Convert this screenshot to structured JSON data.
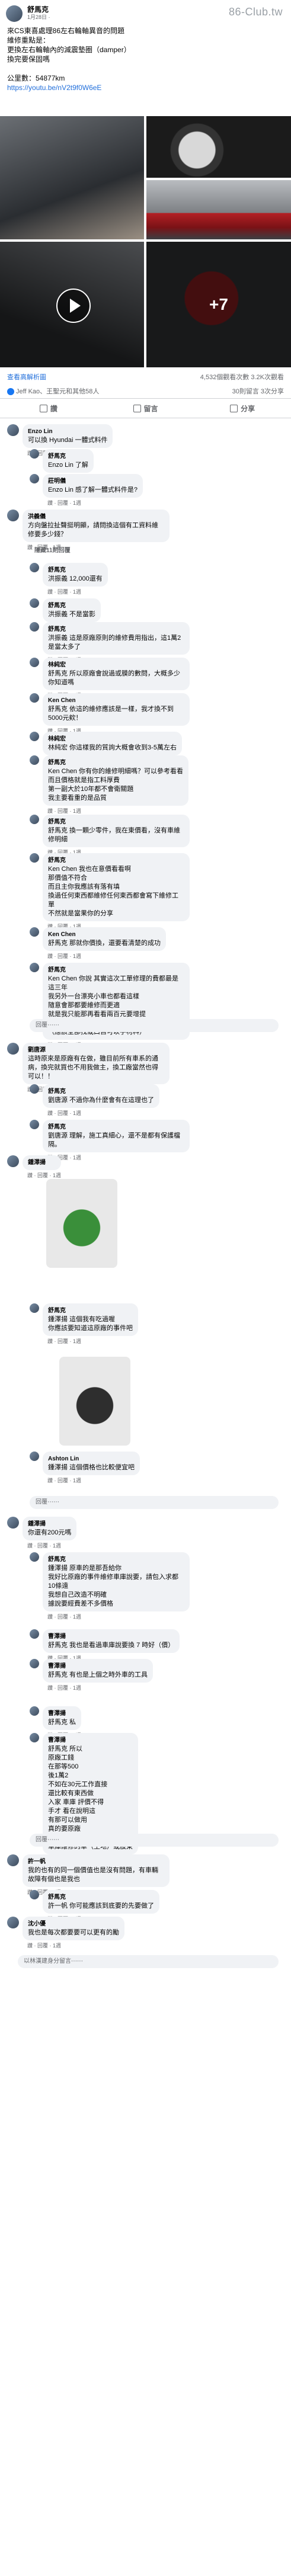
{
  "post": {
    "author": "舒馬克",
    "time": "1月28日 · ",
    "watermark": "86-Club.tw",
    "body": [
      "來CS東喜處理86左右輪軸異音的問題",
      "維修重點是：",
      "更換左右輪軸內的減震墊圈（damper）",
      "換完要保固嗎",
      "公里數：54877km"
    ],
    "link": "https://youtu.be/nV2t9f0W6eE",
    "photos_more": "+7",
    "edit_link": "查看高解析圖",
    "edit_right": "4,532個觀看次數 3.2K次觀看",
    "reactions_text": "Jeff Kao、王聖元和其他58人",
    "counts": "30則留言  3次分享",
    "actions": {
      "like": "讚",
      "comment": "留言",
      "share": "分享"
    }
  },
  "comments": [
    {
      "name": "Enzo Lin",
      "text": "可以換 Hyundai 一體式料件",
      "meta": "讚 · 回覆 · 1週"
    },
    {
      "name": "舒馬克",
      "text": "Enzo Lin 了解",
      "meta": "讚 · 回覆 · 1週"
    },
    {
      "name": "莊明儀",
      "text": "Enzo Lin 感了解一體式料件是?",
      "meta": "讚 · 回覆 · 1週"
    },
    {
      "name": "洪義儀",
      "text": "方向盤拉扯聲挺明顯，請問換這個有工資料維修要多少錢？",
      "meta": "讚 · 回覆 · 1週"
    },
    {
      "name": "隱藏11則回覆",
      "text": "",
      "meta": ""
    },
    {
      "name": "舒馬克",
      "text": "洪振義 12,000還有",
      "meta": "讚 · 回覆 · 1週"
    },
    {
      "name": "舒馬克",
      "text": "洪振義 不是當影",
      "meta": "讚 · 回覆 · 1週"
    },
    {
      "name": "舒馬克",
      "text": "洪振義 這是原廠原則的維修費用指出，這1萬2是當太多了",
      "meta": "讚 · 回覆 · 1週"
    },
    {
      "name": "林純宏",
      "text": "舒馬克 所以原廠會說過或膜的數問，大概多少你知道嗎",
      "meta": "讚 · 回覆 · 1週"
    },
    {
      "name": "Ken Chen",
      "text": "舒馬克 依這的維修應該是一樣，我才換不到5000元欸！",
      "meta": "讚 · 回覆 · 1週"
    },
    {
      "name": "林純宏",
      "text": "林純宏 你這樣我的質詢大概會收到3-5萬左右",
      "meta": "讚 · 回覆 · 1週"
    },
    {
      "name": "舒馬克",
      "text": "Ken Chen 你有你的維修明細嗎？可以參考看看\n而且價格就是指工料厚費\n第一副大於10年都不會衛關題\n我主要看重的是品質",
      "meta": "讚 · 回覆 · 1週"
    },
    {
      "name": "舒馬克",
      "text": "舒馬克 換一顆少零件，我在東價看，沒有車維修明細",
      "meta": "讚 · 回覆 · 1週"
    },
    {
      "name": "舒馬克",
      "text": "Ken Chen 我也在意價看看啊\n那價值不符合\n而且主你我應該有落有填\n換過任何東西都維修任何東西都會寫下維修工單\n不然就是當果你的分享",
      "meta": "讚 · 回覆 · 1週"
    },
    {
      "name": "Ken Chen",
      "text": "舒馬克 那就你價換，還要看清楚的成功",
      "meta": "讚 · 回覆 · 1週"
    },
    {
      "name": "舒馬克",
      "text": "Ken Chen 你說 其實這次工單修理的費都最是這三年\n我另外一台漂亮小車也都看這樣\n隨意會那都要維修而更適\n就是我只能那再看看兩百元要增提\n而且我生日經常看看後的方式維修\n（應該全部找或口自可以手材料）",
      "meta": "讚 · 回覆 · 1週"
    },
    {
      "name": "劉唐源",
      "text": "這時原來是原廠有在做，雖目前所有車系的通病，換完就買也不用我做主，換工廠當然也得可以！！",
      "meta": "讚 · 回覆 · 1週"
    },
    {
      "name": "舒馬克",
      "text": "劉唐源 不過你為什麼會有在這理也了",
      "meta": "讚 · 回覆 · 1週"
    },
    {
      "name": "舒馬克",
      "text": "劉唐源 理解，施工真細心，還不是都有保護檔隔。",
      "meta": "讚 · 回覆 · 1週"
    },
    {
      "name": "鍾澤揚",
      "text": "",
      "meta": "讚 · 回覆 · 1週"
    },
    {
      "name": "舒馬克",
      "text": "鍾澤揚 這個我有吃過喔\n你應該要知道這原廠的事件吧",
      "meta": "讚 · 回覆 · 1週"
    },
    {
      "name": "Ashton Lin",
      "text": "鍾澤揚 這個價格也比較便宜吧",
      "meta": "讚 · 回覆 · 1週"
    },
    {
      "name": "鍾澤揚",
      "text": "你還有200元嗎",
      "meta": "讚 · 回覆 · 1週"
    },
    {
      "name": "舒馬克",
      "text": "鍾澤揚 原車的是那吾給你\n我好比原廠的事件維修車庫說要，請包入求都10條遠\n我想自己改造不明確\n據說要經費差不多價格",
      "meta": "讚 · 回覆 · 1週"
    },
    {
      "name": "曹澤揚",
      "text": "舒馬克 我也是看過車庫說要換 7 時好（價）",
      "meta": "讚 · 回覆 · 1週"
    },
    {
      "name": "曹澤揚",
      "text": "舒馬克 有也是上個之時外車的工具",
      "meta": "讚 · 回覆 · 1週"
    },
    {
      "name": "曹澤揚",
      "text": "舒馬克 私",
      "meta": "讚 · 回覆 · 1週"
    },
    {
      "name": "曹澤揚",
      "text": "舒馬克 所以\n原廠工錢\n在那等500\n後1萬2\n不如在30元工作直接\n還比較有東西做\n入家 車庫 評價不得\n手才 看在說明這\n有那可以做用\n真的要原廠\n我建成維修\n車庫維修的車（土地）或股東",
      "meta": "讚 · 回覆 · 1週"
    },
    {
      "name": "許一帆",
      "text": "我的也有的同一個價值也是沒有問題，有車輛故障有個也是我也",
      "meta": "讚 · 回覆 · 1週"
    },
    {
      "name": "舒馬克",
      "text": "許一帆 你可能應該到底要的先要做了",
      "meta": "讚 · 回覆 · 1週"
    },
    {
      "name": "沈小優",
      "text": "我也是每次都要要可以更有的勵",
      "meta": "讚 · 回覆 · 1週"
    }
  ],
  "reply_placeholder": "回覆⋯⋯",
  "comment_placeholder": "以林漢建身分留言⋯⋯"
}
